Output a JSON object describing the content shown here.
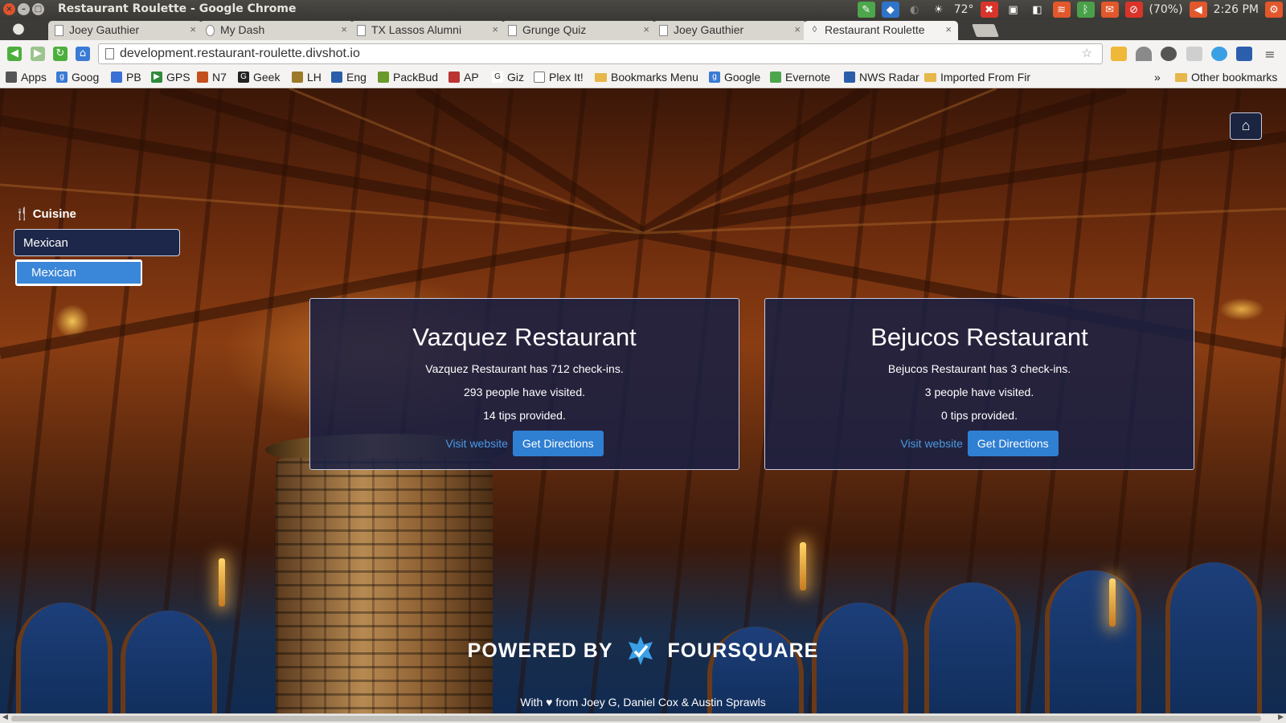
{
  "os": {
    "window_title": "Restaurant Roulette - Google Chrome",
    "weather": "72°",
    "battery": "(70%)",
    "clock": "2:26 PM"
  },
  "tabs": [
    {
      "label": "Joey Gauthier",
      "active": false
    },
    {
      "label": "My Dash",
      "active": false
    },
    {
      "label": "TX Lassos Alumni",
      "active": false
    },
    {
      "label": "Grunge Quiz",
      "active": false
    },
    {
      "label": "Joey Gauthier",
      "active": false
    },
    {
      "label": "Restaurant Roulette",
      "active": true
    }
  ],
  "toolbar": {
    "url": "development.restaurant-roulette.divshot.io"
  },
  "bookmarks": {
    "items": [
      "Apps",
      "Goog",
      "PB",
      "GPS",
      "N7",
      "Geek",
      "LH",
      "Eng",
      "PackBud",
      "AP",
      "Giz",
      "Plex It!",
      "Bookmarks Menu",
      "Google",
      "Evernote",
      "NWS Radar",
      "Imported From Fir"
    ],
    "chevron": "»",
    "other": "Other bookmarks"
  },
  "page": {
    "cuisine_label": "Cuisine",
    "cuisine_value": "Mexican",
    "suggestions": [
      "Mexican"
    ],
    "restaurants": [
      {
        "name": "Vazquez Restaurant",
        "checkins": "Vazquez Restaurant has 712 check-ins.",
        "visited": "293 people have visited.",
        "tips": "14 tips provided.",
        "link": "Visit website",
        "button": "Get Directions"
      },
      {
        "name": "Bejucos Restaurant",
        "checkins": "Bejucos Restaurant has 3 check-ins.",
        "visited": "3 people have visited.",
        "tips": "0 tips provided.",
        "link": "Visit website",
        "button": "Get Directions"
      }
    ],
    "powered_by": "POWERED BY",
    "powered_brand": "FOURSQUARE",
    "credits": "With ♥ from Joey G, Daniel Cox & Austin Sprawls"
  },
  "colors": {
    "card_bg": "#182044",
    "button": "#2f7fd2",
    "link": "#4a9ae6",
    "foursquare": "#3aa0e6"
  }
}
